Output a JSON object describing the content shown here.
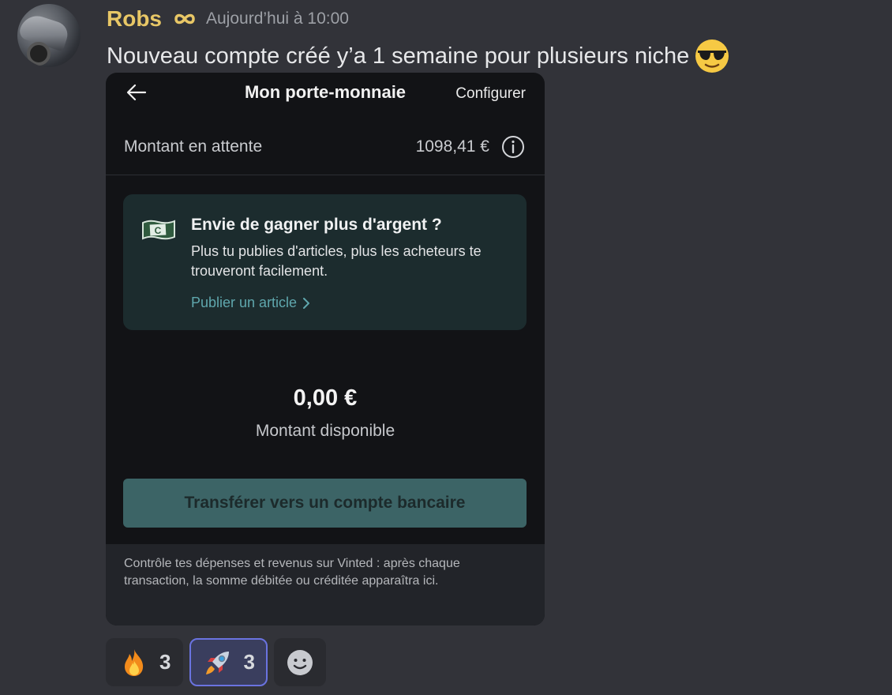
{
  "message": {
    "username": "Robs",
    "badge_icon": "infinity-icon",
    "timestamp": "Aujourd’hui à 10:00",
    "text": "Nouveau compte créé y’a 1 semaine pour plusieurs niche",
    "emoji_icon": "sunglasses-face-icon"
  },
  "wallet": {
    "title": "Mon porte-monnaie",
    "configure": "Configurer",
    "pending_label": "Montant en attente",
    "pending_value": "1098,41 €",
    "promo": {
      "title": "Envie de gagner plus d'argent ?",
      "body": "Plus tu publies d'articles, plus les acheteurs te trouveront facilement.",
      "link": "Publier un article"
    },
    "balance_amount": "0,00 €",
    "balance_label": "Montant disponible",
    "transfer_button": "Transférer vers un compte bancaire",
    "footer": "Contrôle tes dépenses et revenus sur Vinted : après chaque transaction, la somme débitée ou créditée apparaîtra ici."
  },
  "reactions": [
    {
      "icon": "fire-icon",
      "count": "3",
      "active": false
    },
    {
      "icon": "rocket-icon",
      "count": "3",
      "active": true
    }
  ],
  "colors": {
    "background": "#323339",
    "username": "#e8c766",
    "accent_link": "#5fa7ad",
    "transfer_button": "#3c6466",
    "active_reaction_border": "#6a73e0"
  }
}
